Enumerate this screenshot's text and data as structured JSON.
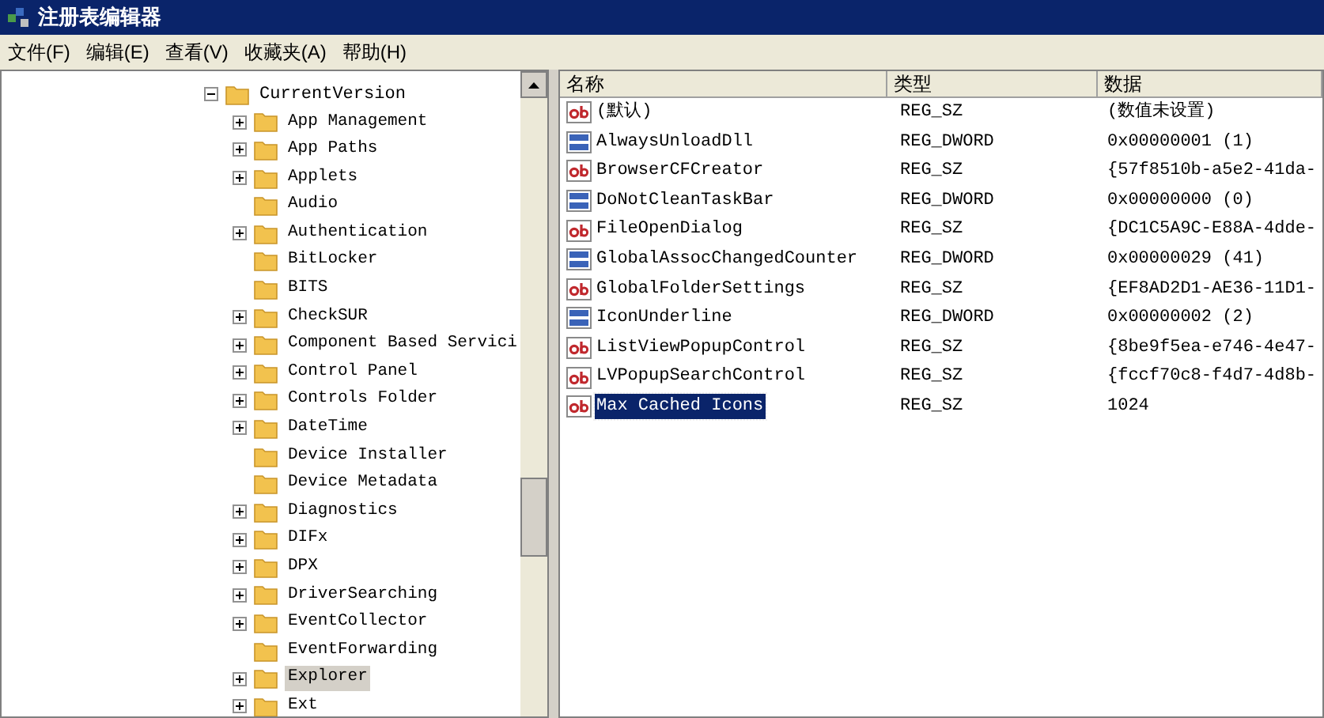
{
  "window": {
    "title": "注册表编辑器"
  },
  "menu": [
    "文件(F)",
    "编辑(E)",
    "查看(V)",
    "收藏夹(A)",
    "帮助(H)"
  ],
  "tree": [
    {
      "label": "CurrentVersion",
      "expanded": true,
      "selected": false,
      "children": [
        {
          "label": "App Management",
          "expandable": true,
          "selected": false
        },
        {
          "label": "App Paths",
          "expandable": true,
          "selected": false
        },
        {
          "label": "Applets",
          "expandable": true,
          "selected": false
        },
        {
          "label": "Audio",
          "expandable": false,
          "selected": false
        },
        {
          "label": "Authentication",
          "expandable": true,
          "selected": false
        },
        {
          "label": "BitLocker",
          "expandable": false,
          "selected": false
        },
        {
          "label": "BITS",
          "expandable": false,
          "selected": false
        },
        {
          "label": "CheckSUR",
          "expandable": true,
          "selected": false
        },
        {
          "label": "Component Based Servici",
          "expandable": true,
          "selected": false
        },
        {
          "label": "Control Panel",
          "expandable": true,
          "selected": false
        },
        {
          "label": "Controls Folder",
          "expandable": true,
          "selected": false
        },
        {
          "label": "DateTime",
          "expandable": true,
          "selected": false
        },
        {
          "label": "Device Installer",
          "expandable": false,
          "selected": false
        },
        {
          "label": "Device Metadata",
          "expandable": false,
          "selected": false
        },
        {
          "label": "Diagnostics",
          "expandable": true,
          "selected": false
        },
        {
          "label": "DIFx",
          "expandable": true,
          "selected": false
        },
        {
          "label": "DPX",
          "expandable": true,
          "selected": false
        },
        {
          "label": "DriverSearching",
          "expandable": true,
          "selected": false
        },
        {
          "label": "EventCollector",
          "expandable": true,
          "selected": false
        },
        {
          "label": "EventForwarding",
          "expandable": false,
          "selected": false
        },
        {
          "label": "Explorer",
          "expandable": true,
          "selected": true
        },
        {
          "label": "Ext",
          "expandable": true,
          "selected": false
        }
      ]
    }
  ],
  "table": {
    "columns": [
      "名称",
      "类型",
      "数据"
    ],
    "rows": [
      {
        "kind": "sz",
        "name": "(默认)",
        "type": "REG_SZ",
        "data": "(数值未设置)",
        "selected": false
      },
      {
        "kind": "dword",
        "name": "AlwaysUnloadDll",
        "type": "REG_DWORD",
        "data": "0x00000001 (1)",
        "selected": false
      },
      {
        "kind": "sz",
        "name": "BrowserCFCreator",
        "type": "REG_SZ",
        "data": "{57f8510b-a5e2-41da-",
        "selected": false
      },
      {
        "kind": "dword",
        "name": "DoNotCleanTaskBar",
        "type": "REG_DWORD",
        "data": "0x00000000 (0)",
        "selected": false
      },
      {
        "kind": "sz",
        "name": "FileOpenDialog",
        "type": "REG_SZ",
        "data": "{DC1C5A9C-E88A-4dde-",
        "selected": false
      },
      {
        "kind": "dword",
        "name": "GlobalAssocChangedCounter",
        "type": "REG_DWORD",
        "data": "0x00000029 (41)",
        "selected": false
      },
      {
        "kind": "sz",
        "name": "GlobalFolderSettings",
        "type": "REG_SZ",
        "data": "{EF8AD2D1-AE36-11D1-",
        "selected": false
      },
      {
        "kind": "dword",
        "name": "IconUnderline",
        "type": "REG_DWORD",
        "data": "0x00000002 (2)",
        "selected": false
      },
      {
        "kind": "sz",
        "name": "ListViewPopupControl",
        "type": "REG_SZ",
        "data": "{8be9f5ea-e746-4e47-",
        "selected": false
      },
      {
        "kind": "sz",
        "name": "LVPopupSearchControl",
        "type": "REG_SZ",
        "data": "{fccf70c8-f4d7-4d8b-",
        "selected": false
      },
      {
        "kind": "sz",
        "name": "Max Cached Icons",
        "type": "REG_SZ",
        "data": "1024",
        "selected": true
      }
    ]
  }
}
